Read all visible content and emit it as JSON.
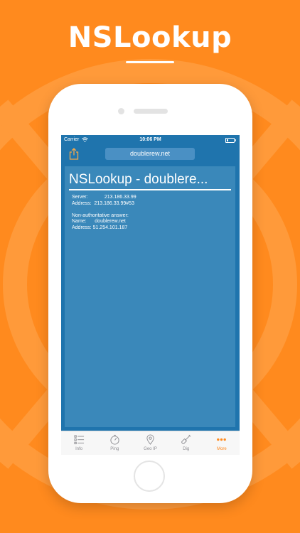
{
  "headline": "NSLookup",
  "status_bar": {
    "carrier": "Carrier",
    "time": "10:06 PM",
    "battery_level": 0.2
  },
  "toolbar": {
    "share_icon": "share-icon",
    "url_value": "doublerew.net"
  },
  "result": {
    "title": "NSLookup - doublere...",
    "text": "Server:            213.186.33.99\nAddress:  213.186.33.99#53\n\nNon-authoritative answer:\nName:      doublerew.net\nAddress: 51.254.101.187"
  },
  "tabs": [
    {
      "label": "Info",
      "icon": "list-icon"
    },
    {
      "label": "Ping",
      "icon": "stopwatch-icon"
    },
    {
      "label": "Geo IP",
      "icon": "location-pin-icon"
    },
    {
      "label": "Dig",
      "icon": "shovel-icon"
    },
    {
      "label": "More",
      "icon": "more-dots-icon",
      "active": true
    }
  ],
  "colors": {
    "background": "#ff8a1e",
    "screen": "#1f74ad",
    "panel": "#3a88ba",
    "active_tab": "#ff8a1e",
    "inactive_tab": "#8e8e93"
  }
}
